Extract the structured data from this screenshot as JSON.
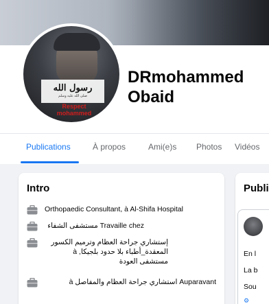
{
  "profile": {
    "name_line1": "DRmohammed",
    "name_line2": "Obaid",
    "avatar_text_main": "رسول الله",
    "avatar_text_sub": "صلى الله عليه وسلم",
    "avatar_text_red1": "Respect",
    "avatar_text_red2": "mohammed"
  },
  "tabs": [
    {
      "label": "Publications",
      "active": true
    },
    {
      "label": "À propos",
      "active": false
    },
    {
      "label": "Ami(e)s",
      "active": false
    },
    {
      "label": "Photos",
      "active": false
    },
    {
      "label": "Vidéos",
      "active": false
    }
  ],
  "intro": {
    "title": "Intro",
    "items": [
      {
        "icon": "briefcase-icon",
        "text": "Orthopaedic Consultant, à Al-Shifa Hospital",
        "rtl": false
      },
      {
        "icon": "briefcase-icon",
        "text": "Travaille chez مستشفى الشفاء",
        "rtl": true
      },
      {
        "icon": "briefcase-icon",
        "text": "إستشاري جراحة العظام وترميم الكسور المعقدة_أطباء بلا حدود بلجيكا, à مستشفى العودة",
        "rtl": true
      },
      {
        "icon": "briefcase-icon",
        "text": "Auparavant استشاري جراحة العظام والمفاصل à",
        "rtl": true
      }
    ]
  },
  "publications": {
    "title": "Publi",
    "post_lines": [
      "En l",
      "La b",
      "Sou"
    ],
    "post_icon": "gear-icon"
  },
  "colors": {
    "accent": "#1877f2",
    "background": "#f0f2f5"
  }
}
